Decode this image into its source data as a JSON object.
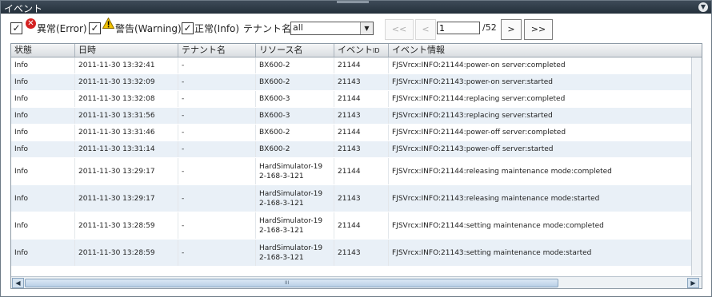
{
  "panel": {
    "title": "イベント",
    "collapse_icon": "chevron-down-icon"
  },
  "filters": {
    "error": {
      "checked": true,
      "label": "異常(Error)",
      "icon": "error-icon"
    },
    "warning": {
      "checked": true,
      "label": "警告(Warning)",
      "icon": "warning-icon"
    },
    "info": {
      "checked": true,
      "label": "正常(Info)"
    },
    "tenant_label": "テナント名:",
    "tenant_value": "all"
  },
  "pager": {
    "first": "<<",
    "prev": "<",
    "page": "1",
    "total": "/52",
    "next": ">",
    "last": ">>"
  },
  "table": {
    "headers": {
      "status": "状態",
      "datetime": "日時",
      "tenant": "テナント名",
      "resource": "リソース名",
      "event_id_main": "イベント",
      "event_id_sub": "ID",
      "event_info": "イベント情報"
    },
    "rows": [
      {
        "status": "Info",
        "datetime": "2011-11-30 13:32:41",
        "tenant": "-",
        "resource": "BX600-2",
        "id": "21144",
        "info": "FJSVrcx:INFO:21144:power-on server:completed"
      },
      {
        "status": "Info",
        "datetime": "2011-11-30 13:32:09",
        "tenant": "-",
        "resource": "BX600-2",
        "id": "21143",
        "info": "FJSVrcx:INFO:21143:power-on server:started"
      },
      {
        "status": "Info",
        "datetime": "2011-11-30 13:32:08",
        "tenant": "-",
        "resource": "BX600-3",
        "id": "21144",
        "info": "FJSVrcx:INFO:21144:replacing server:completed"
      },
      {
        "status": "Info",
        "datetime": "2011-11-30 13:31:56",
        "tenant": "-",
        "resource": "BX600-3",
        "id": "21143",
        "info": "FJSVrcx:INFO:21143:replacing server:started"
      },
      {
        "status": "Info",
        "datetime": "2011-11-30 13:31:46",
        "tenant": "-",
        "resource": "BX600-2",
        "id": "21144",
        "info": "FJSVrcx:INFO:21144:power-off server:completed"
      },
      {
        "status": "Info",
        "datetime": "2011-11-30 13:31:14",
        "tenant": "-",
        "resource": "BX600-2",
        "id": "21143",
        "info": "FJSVrcx:INFO:21143:power-off server:started"
      },
      {
        "status": "Info",
        "datetime": "2011-11-30 13:29:17",
        "tenant": "-",
        "resource": "HardSimulator-19\n2-168-3-121",
        "id": "21144",
        "info": "FJSVrcx:INFO:21144:releasing maintenance mode:completed"
      },
      {
        "status": "Info",
        "datetime": "2011-11-30 13:29:17",
        "tenant": "-",
        "resource": "HardSimulator-19\n2-168-3-121",
        "id": "21143",
        "info": "FJSVrcx:INFO:21143:releasing maintenance mode:started"
      },
      {
        "status": "Info",
        "datetime": "2011-11-30 13:28:59",
        "tenant": "-",
        "resource": "HardSimulator-19\n2-168-3-121",
        "id": "21144",
        "info": "FJSVrcx:INFO:21144:setting maintenance mode:completed"
      },
      {
        "status": "Info",
        "datetime": "2011-11-30 13:28:59",
        "tenant": "-",
        "resource": "HardSimulator-19\n2-168-3-121",
        "id": "21143",
        "info": "FJSVrcx:INFO:21143:setting maintenance mode:started"
      }
    ]
  },
  "scrollbar": {
    "left_icon": "scroll-left-icon",
    "right_icon": "scroll-right-icon",
    "grip": "III"
  },
  "colors": {
    "titlebar": "#2c3844",
    "row_alt": "#e9f0f7",
    "error": "#d42323",
    "warning": "#f2c200"
  }
}
